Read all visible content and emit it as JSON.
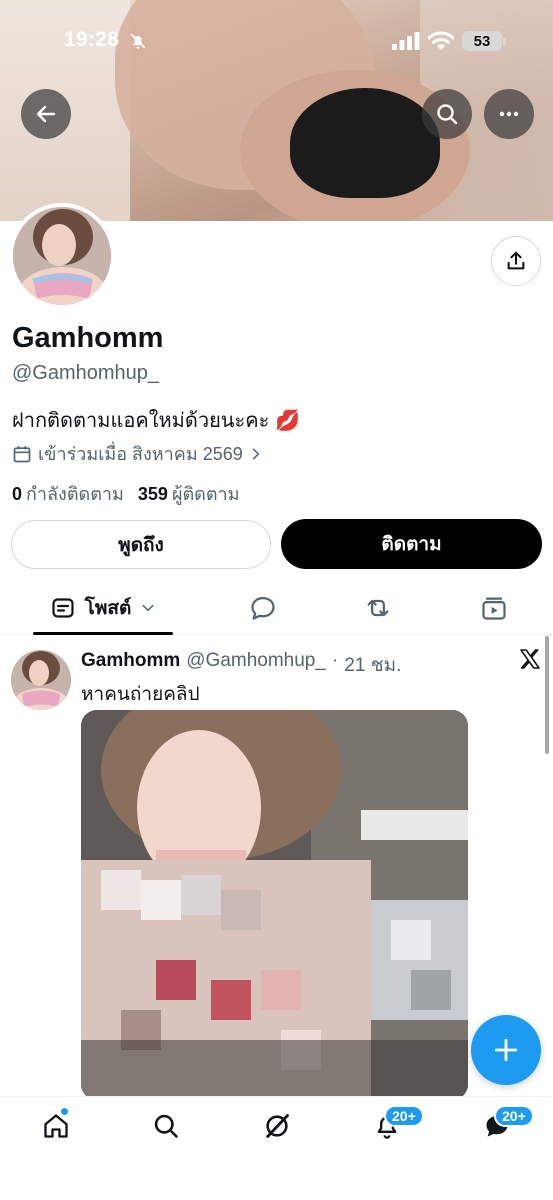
{
  "status_bar": {
    "time": "19:28",
    "battery": "53"
  },
  "profile": {
    "display_name": "Gamhomm",
    "handle": "@Gamhomhup_",
    "bio": "ฝากติดตามแอคใหม่ด้วยนะคะ",
    "bio_emoji": "💋",
    "joined": "เข้าร่วมเมื่อ สิงหาคม 2569",
    "following_count": "0",
    "following_label": "กำลังติดตาม",
    "followers_count": "359",
    "followers_label": "ผู้ติดตาม"
  },
  "actions": {
    "mention_label": "พูดถึง",
    "follow_label": "ติดตาม"
  },
  "tabs": {
    "posts_label": "โพสต์"
  },
  "post": {
    "author_name": "Gamhomm",
    "author_handle": "@Gamhomhup_",
    "separator": "·",
    "time": "21 ชม.",
    "text": "หาคนถ่ายคลิป"
  },
  "nav": {
    "notifications_badge": "20+",
    "messages_badge": "20+"
  },
  "colors": {
    "accent": "#1d9bf0",
    "text_primary": "#0f1419",
    "text_secondary": "#536471",
    "follow_button": "#000000"
  }
}
